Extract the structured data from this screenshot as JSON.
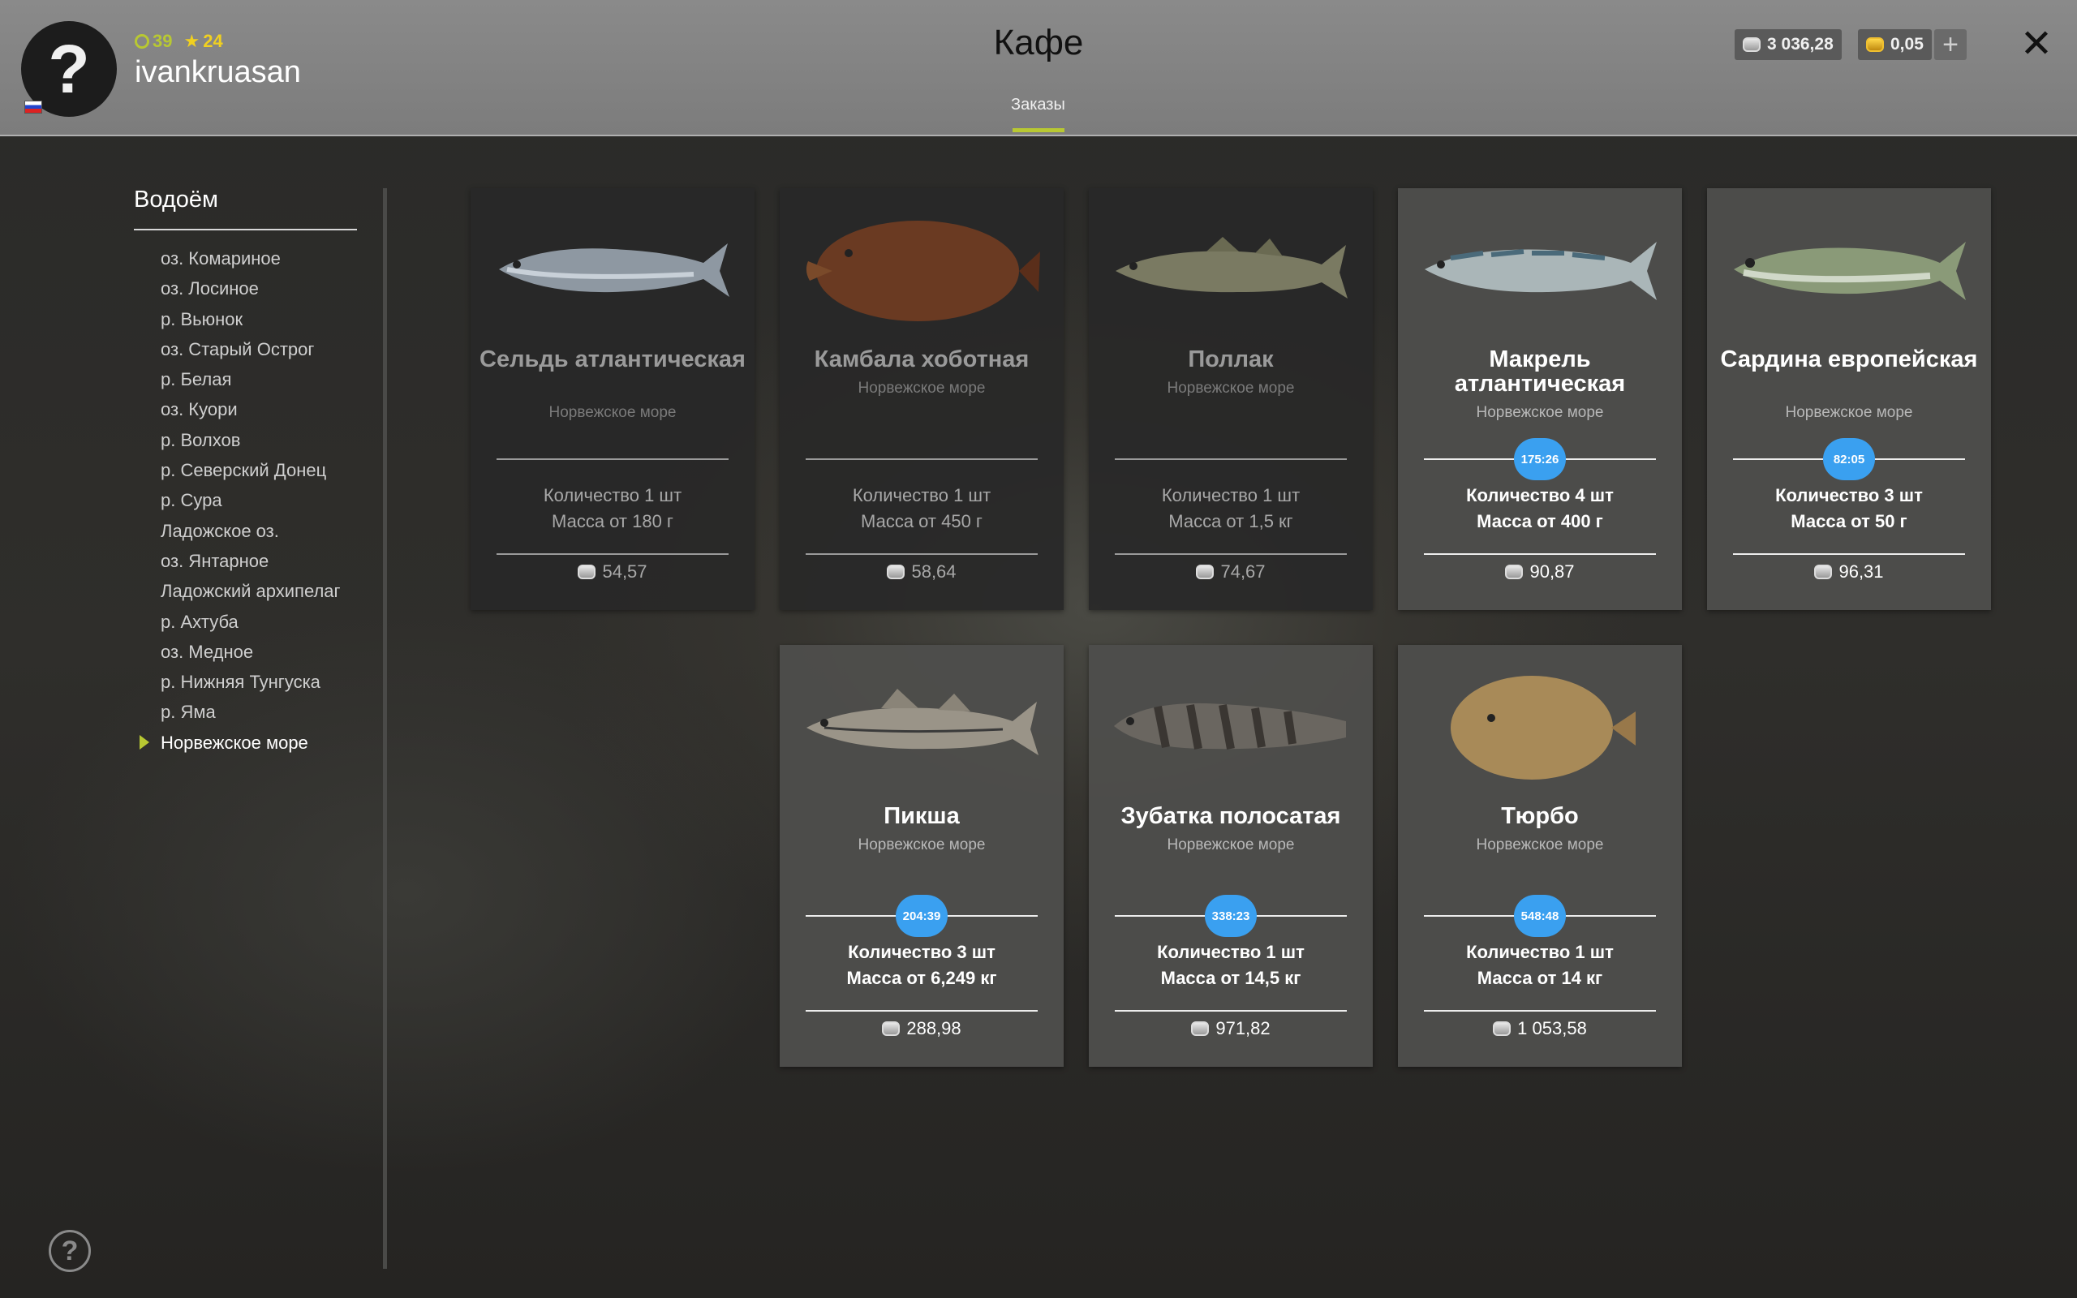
{
  "header": {
    "title": "Кафе",
    "tab": "Заказы",
    "username": "ivankruasan",
    "level": "39",
    "stars": "24",
    "silver": "3 036,28",
    "gold": "0,05",
    "accent": "#b8c832"
  },
  "sidebar": {
    "title": "Водоём",
    "items": [
      "оз. Комариное",
      "оз. Лосиное",
      "р. Вьюнок",
      "оз. Старый Острог",
      "р. Белая",
      "оз. Куори",
      "р. Волхов",
      "р. Северский Донец",
      "р. Сура",
      "Ладожское оз.",
      "оз. Янтарное",
      "Ладожский архипелаг",
      "р. Ахтуба",
      "оз. Медное",
      "р. Нижняя Тунгуска",
      "р. Яма",
      "Норвежское море"
    ],
    "active_index": 16
  },
  "cards": [
    {
      "name": "Сельдь атлантическая",
      "location": "Норвежское море",
      "qty": "Количество 1 шт",
      "mass": "Масса от 180 г",
      "price": "54,57",
      "timer": "",
      "highlighted": false
    },
    {
      "name": "Камбала хоботная",
      "location": "Норвежское море",
      "qty": "Количество 1 шт",
      "mass": "Масса от 450 г",
      "price": "58,64",
      "timer": "",
      "highlighted": false
    },
    {
      "name": "Поллак",
      "location": "Норвежское море",
      "qty": "Количество 1 шт",
      "mass": "Масса от 1,5 кг",
      "price": "74,67",
      "timer": "",
      "highlighted": false
    },
    {
      "name": "Макрель атлантическая",
      "location": "Норвежское море",
      "qty": "Количество 4 шт",
      "mass": "Масса от 400 г",
      "price": "90,87",
      "timer": "175:26",
      "highlighted": true
    },
    {
      "name": "Сардина европейская",
      "location": "Норвежское море",
      "qty": "Количество 3 шт",
      "mass": "Масса от 50 г",
      "price": "96,31",
      "timer": "82:05",
      "highlighted": true
    },
    {
      "name": "Пикша",
      "location": "Норвежское море",
      "qty": "Количество 3 шт",
      "mass": "Масса от 6,249 кг",
      "price": "288,98",
      "timer": "204:39",
      "highlighted": true
    },
    {
      "name": "Зубатка полосатая",
      "location": "Норвежское море",
      "qty": "Количество 1 шт",
      "mass": "Масса от 14,5 кг",
      "price": "971,82",
      "timer": "338:23",
      "highlighted": true
    },
    {
      "name": "Тюрбо",
      "location": "Норвежское море",
      "qty": "Количество 1 шт",
      "mass": "Масса от 14 кг",
      "price": "1 053,58",
      "timer": "548:48",
      "highlighted": true
    }
  ]
}
